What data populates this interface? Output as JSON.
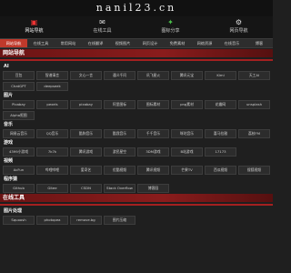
{
  "site": {
    "logo": "nanil23.cn"
  },
  "topnav": [
    {
      "icon": "▣",
      "label": "网站导航",
      "active": true
    },
    {
      "icon": "✉",
      "label": "在线工具",
      "active": false
    },
    {
      "icon": "✦",
      "label": "图标分享",
      "active": false,
      "green": true
    },
    {
      "icon": "⚙",
      "label": "网页导航",
      "active": false
    }
  ],
  "tabs": [
    "网站导航",
    "在线工具",
    "常用网站",
    "在线翻译",
    "视频图片",
    "网页设计",
    "免费素材",
    "网络资源",
    "在线音乐",
    "博客"
  ],
  "sections": [
    {
      "title": "网站导航",
      "categories": [
        {
          "title": "AI",
          "items": [
            "豆包",
            "智谱清言",
            "文心一言",
            "通义千问",
            "讯飞星火",
            "腾讯元宝",
            "Kimi",
            "天工AI",
            "ChatGPT",
            "deepseek"
          ]
        },
        {
          "title": "图片",
          "items": [
            "Pixabay",
            "pexels",
            "pixabay",
            "阿里图标",
            "图标素材",
            "png素材",
            "花瓣网",
            "unsplash",
            "Alpha抠图"
          ]
        },
        {
          "title": "音乐",
          "items": [
            "网易云音乐",
            "QQ音乐",
            "酷狗音乐",
            "酷我音乐",
            "千千音乐",
            "咪咕音乐",
            "喜马拉雅",
            "荔枝FM"
          ]
        },
        {
          "title": "游戏",
          "items": [
            "4399小游戏",
            "7k7k",
            "腾讯游戏",
            "游民星空",
            "3DM游戏",
            "B站游戏",
            "17173"
          ]
        },
        {
          "title": "视频",
          "items": [
            "AcFun",
            "哔哩哔哩",
            "爱奇艺",
            "优酷视频",
            "腾讯视频",
            "芒果TV",
            "西瓜视频",
            "搜狐视频"
          ]
        },
        {
          "title": "程序猿",
          "items": [
            "Github",
            "Gitee",
            "CSDN",
            "Stack Overflow",
            "博客园"
          ]
        }
      ]
    },
    {
      "title": "在线工具",
      "categories": [
        {
          "title": "图片处理",
          "items": [
            "Squoosh",
            "photopea",
            "remove.bg",
            "图片压缩"
          ]
        }
      ]
    }
  ]
}
